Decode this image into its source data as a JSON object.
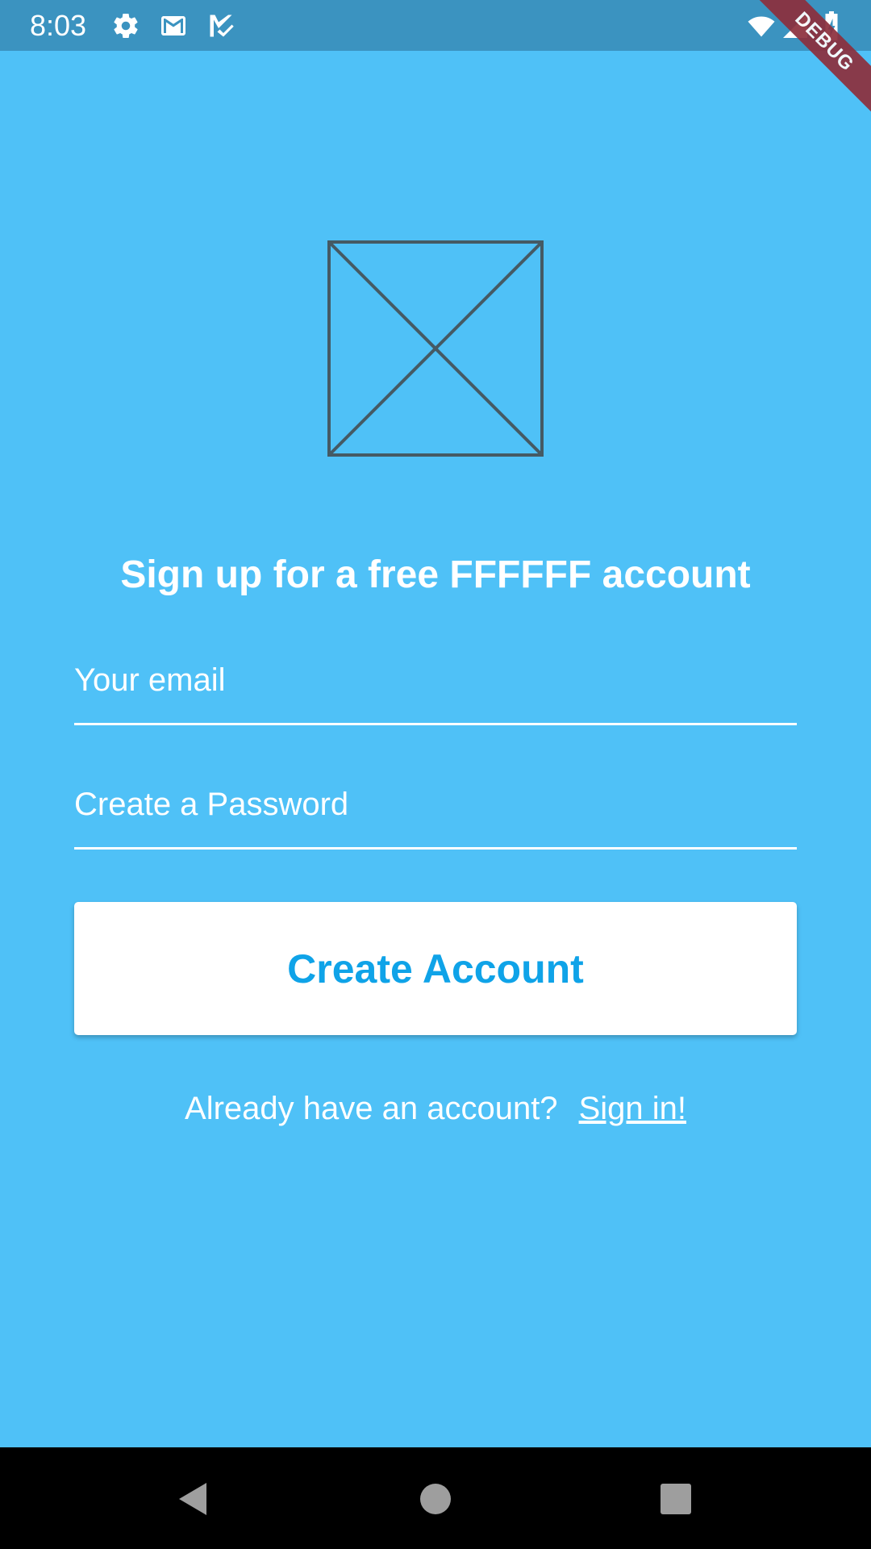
{
  "status_bar": {
    "time": "8:03",
    "icons": [
      "gear-icon",
      "gmail-icon",
      "task-icon",
      "wifi-icon",
      "signal-icon",
      "battery-charging-icon"
    ]
  },
  "debug_banner": {
    "label": "DEBUG"
  },
  "headline": "Sign up for a free FFFFFF account",
  "form": {
    "email_placeholder": "Your email",
    "email_value": "",
    "password_placeholder": "Create a Password",
    "password_value": ""
  },
  "create_button_label": "Create Account",
  "signin": {
    "prompt": "Already have an account?",
    "link_label": "Sign in!"
  },
  "nav_bar": {
    "buttons": [
      "back-icon",
      "home-icon",
      "recents-icon"
    ]
  },
  "colors": {
    "background": "#4fc1f7",
    "status_bar": "#3b93c0",
    "accent": "#0fa3e8",
    "text": "#ffffff",
    "debug": "#8d2f3c"
  }
}
